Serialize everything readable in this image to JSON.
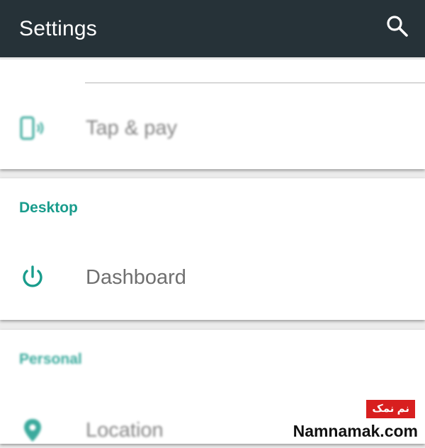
{
  "appbar": {
    "title": "Settings",
    "search_icon": "search-icon"
  },
  "colors": {
    "appbar_bg": "#263238",
    "accent": "#199c8c",
    "label_text": "#6f6f6f"
  },
  "sections": {
    "wireless": {
      "tap_pay": {
        "label": "Tap & pay",
        "icon": "phone-nfc-icon"
      }
    },
    "desktop": {
      "header": "Desktop",
      "dashboard": {
        "label": "Dashboard",
        "icon": "power-icon"
      }
    },
    "personal": {
      "header": "Personal",
      "location": {
        "label": "Location",
        "icon": "location-pin-icon"
      }
    }
  },
  "watermark": {
    "badge": "نم نمک",
    "site": "Namnamak.com"
  }
}
